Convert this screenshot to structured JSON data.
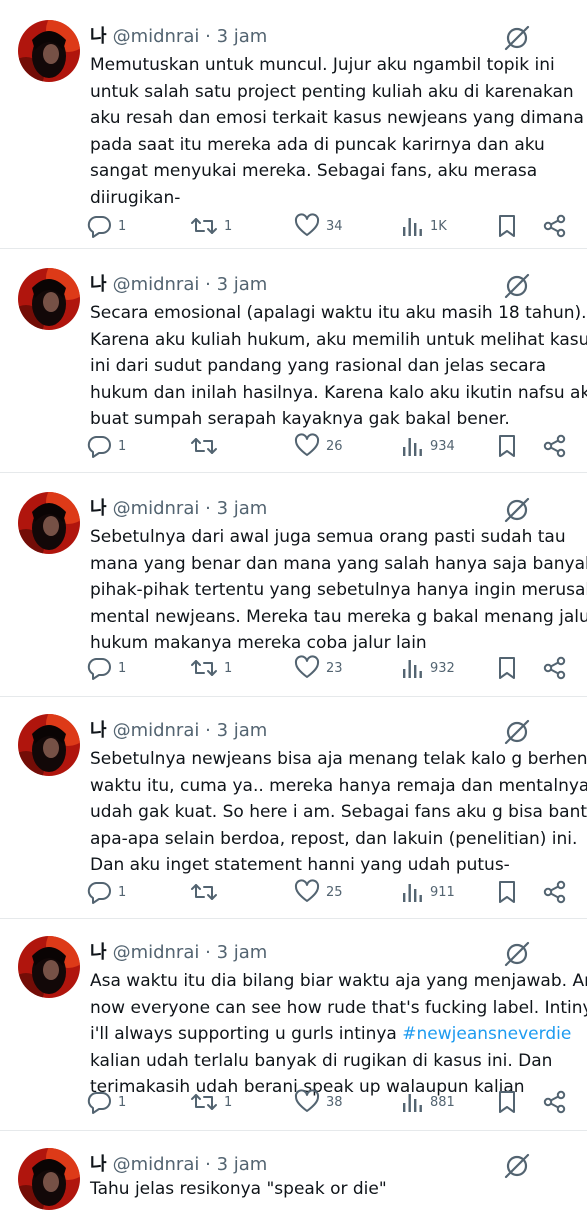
{
  "author": {
    "name": "나",
    "handle": "@midnrai",
    "separator": "·",
    "time": "3 jam"
  },
  "colors": {
    "hashtag": "#1d9bf0",
    "muted": "#536471",
    "text": "#0f1419"
  },
  "icons": {
    "reply": "reply-icon",
    "retweet": "retweet-icon",
    "like": "heart-icon",
    "views": "views-icon",
    "bookmark": "bookmark-icon",
    "share": "share-icon",
    "mute": "mute-icon"
  },
  "tweets": [
    {
      "lines": [
        "Memutuskan untuk muncul. Jujur aku ngambil topik ini",
        "untuk salah satu project penting kuliah aku di karenakan",
        "aku resah dan emosi terkait kasus newjeans yang dimana",
        "pada saat itu mereka ada di puncak karirnya dan aku",
        "sangat menyukai mereka. Sebagai fans, aku merasa",
        "diirugikan-"
      ],
      "replies": "1",
      "retweets": "1",
      "likes": "34",
      "views": "1K"
    },
    {
      "lines": [
        "Secara emosional (apalagi waktu itu aku masih 18 tahun).",
        "Karena aku kuliah hukum, aku memilih untuk melihat kasus",
        "ini dari sudut pandang yang rasional dan jelas secara",
        "hukum dan inilah hasilnya. Karena kalo aku ikutin nafsu aku",
        "buat sumpah serapah kayaknya gak bakal bener."
      ],
      "replies": "1",
      "retweets": "",
      "likes": "26",
      "views": "934"
    },
    {
      "lines": [
        "Sebetulnya dari awal juga semua orang pasti sudah tau",
        "mana yang benar dan mana yang salah hanya saja banyak",
        "pihak-pihak tertentu yang sebetulnya hanya ingin merusak",
        "mental newjeans. Mereka tau mereka g bakal menang jalur",
        "hukum makanya mereka coba jalur lain"
      ],
      "replies": "1",
      "retweets": "1",
      "likes": "23",
      "views": "932"
    },
    {
      "lines": [
        "Sebetulnya newjeans bisa aja menang telak kalo g berhenti",
        "waktu itu, cuma ya.. mereka hanya remaja dan mentalnya",
        "udah gak kuat. So here i am. Sebagai fans aku g bisa bantu",
        "apa-apa selain berdoa, repost, dan lakuin (penelitian) ini.",
        "Dan aku inget statement hanni yang udah putus-"
      ],
      "replies": "1",
      "retweets": "",
      "likes": "25",
      "views": "911"
    },
    {
      "lines": [
        "Asa waktu itu dia bilang biar waktu aja yang menjawab. And",
        "now everyone can see how rude that's fucking label. Intinya",
        "i'll always supporting u gurls intinya ",
        "kalian udah terlalu banyak di rugikan di kasus ini. Dan",
        "terimakasih udah berani speak up walaupun kalian"
      ],
      "hashtag": "#newjeansneverdie",
      "replies": "1",
      "retweets": "1",
      "likes": "38",
      "views": "881"
    },
    {
      "lines": [
        "Tahu jelas resikonya \"speak or die\""
      ]
    }
  ]
}
